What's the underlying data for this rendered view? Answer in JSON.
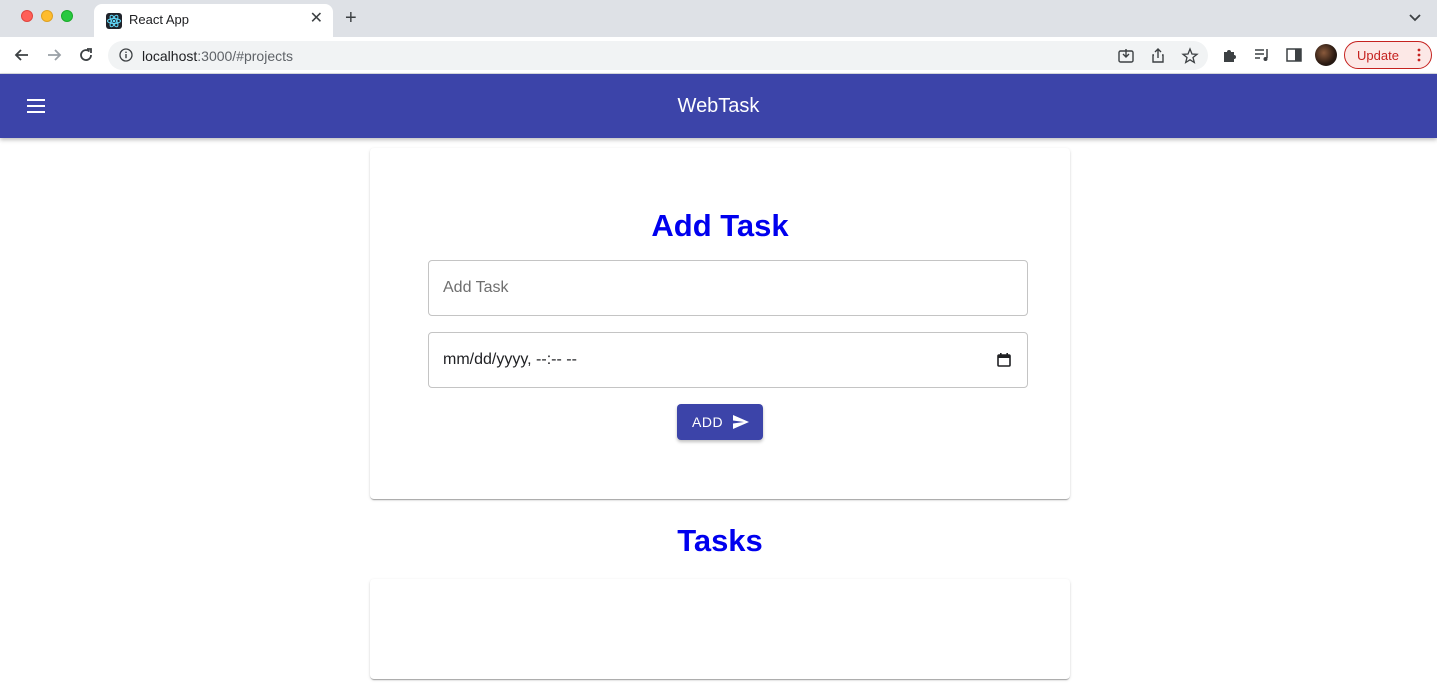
{
  "browser": {
    "tab_title": "React App",
    "tab_close": "✕",
    "new_tab": "+",
    "url_host": "localhost",
    "url_rest": ":3000/#projects",
    "update_label": "Update"
  },
  "app": {
    "title": "WebTask",
    "brand_color": "#3c44a9",
    "heading_color": "#0000ee"
  },
  "add_task": {
    "heading": "Add Task",
    "task_placeholder": "Add Task",
    "date_value": "mm/dd/yyyy, --:-- --",
    "add_button_label": "ADD"
  },
  "tasks": {
    "heading": "Tasks",
    "items": []
  },
  "icons": [
    "back-arrow-icon",
    "forward-arrow-icon",
    "reload-icon",
    "info-icon",
    "install-icon",
    "share-icon",
    "star-icon",
    "extensions-icon",
    "media-icon",
    "side-panel-icon",
    "menu-icon",
    "calendar-icon",
    "send-icon"
  ]
}
